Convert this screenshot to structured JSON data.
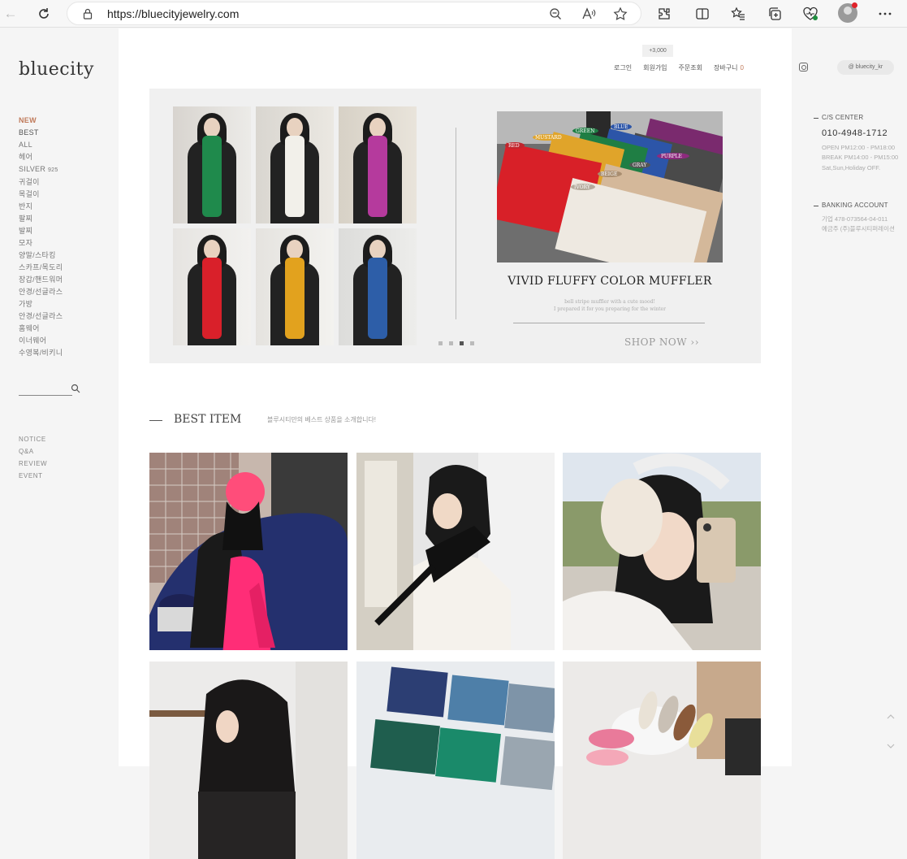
{
  "browser": {
    "url": "https://bluecityjewelry.com"
  },
  "logo": "bluecity",
  "nav": {
    "items": [
      "NEW",
      "BEST",
      "ALL",
      "헤어",
      "SILVER",
      "귀걸이",
      "목걸이",
      "반지",
      "팔찌",
      "발찌",
      "모자",
      "양말/스타킹",
      "스카프/목도리",
      "장갑/핸드워머",
      "안경/선글라스",
      "가방",
      "안경/선글라스",
      "홈웨어",
      "이너웨어",
      "수영복/비키니"
    ],
    "silver_suffix": "925",
    "secondary": [
      "NOTICE",
      "Q&A",
      "REVIEW",
      "EVENT"
    ]
  },
  "top_menu": {
    "badge": "+3,000",
    "login": "로그인",
    "join": "회원가입",
    "order": "주문조회",
    "cart": "장바구니",
    "cart_count": "0"
  },
  "hero": {
    "title": "VIVID FLUFFY COLOR MUFFLER",
    "sub1": "bell stripe muffler with a cute mood!",
    "sub2": "I prepared it for you preparing for the winter",
    "shop_now": "SHOP NOW ››",
    "color_tags": [
      "RED",
      "MUSTARD",
      "GREEN",
      "BLUE",
      "PURPLE",
      "GRAY",
      "BEIGE",
      "IVORY"
    ],
    "tile_scarf_colors": [
      "#1f8a4c",
      "#f2f0ea",
      "#b53a9d",
      "#d9202a",
      "#e2a21e",
      "#2d5ea8"
    ]
  },
  "best": {
    "title": "BEST ITEM",
    "subtitle": "블루시티만의 베스트 상품을 소개합니다!"
  },
  "right": {
    "insta_handle": "@ bluecity_kr",
    "cs_head": "C/S CENTER",
    "phone": "010-4948-1712",
    "open": "OPEN   PM12:00 - PM18:00",
    "break": "BREAK   PM14:00 - PM15:00",
    "off": "Sat,Sun,Holiday OFF.",
    "bank_head": "BANKING ACCOUNT",
    "bank_line": "기업    478-073564-04-011",
    "holder": "예금주 (주)블루시티퍼레이션"
  }
}
